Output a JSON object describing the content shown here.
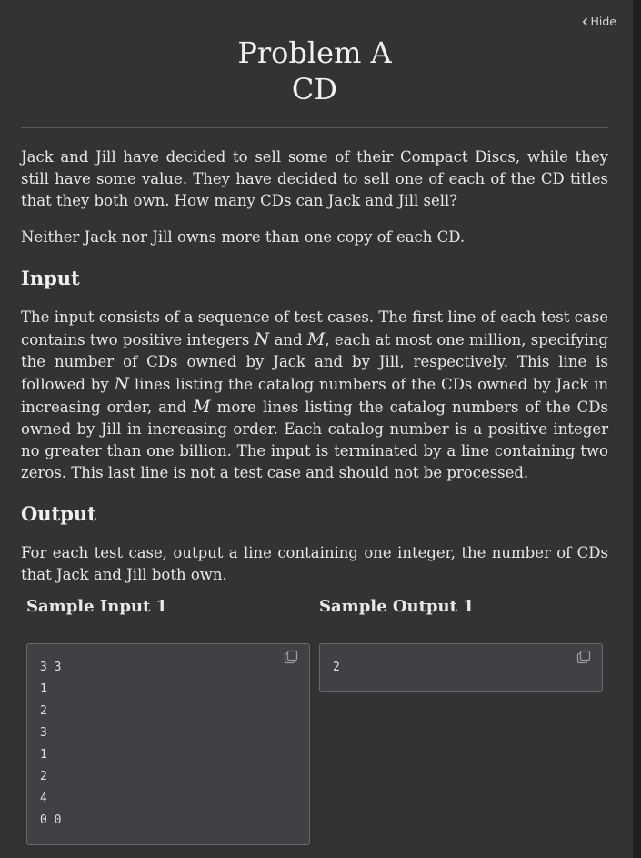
{
  "header": {
    "hide_label": "Hide",
    "title_line1": "Problem A",
    "title_line2": "CD"
  },
  "statement": {
    "p1": "Jack and Jill have decided to sell some of their Compact Discs, while they still have some value. They have decided to sell one of each of the CD titles that they both own. How many CDs can Jack and Jill sell?",
    "p2": "Neither Jack nor Jill owns more than one copy of each CD."
  },
  "input_section": {
    "heading": "Input",
    "text": [
      "The input consists of a sequence of test cases. The first line of each test case contains two positive integers ",
      "N",
      " and ",
      "M",
      ", each at most one million, specifying the number of CDs owned by Jack and by Jill, respectively. This line is followed by ",
      "N",
      " lines listing the catalog numbers of the CDs owned by Jack in increasing order, and ",
      "M",
      " more lines listing the catalog numbers of the CDs owned by Jill in increasing order. Each catalog number is a positive integer no greater than one billion. The input is terminated by a line containing two zeros. This last line is not a test case and should not be processed."
    ]
  },
  "output_section": {
    "heading": "Output",
    "text": "For each test case, output a line containing one integer, the number of CDs that Jack and Jill both own."
  },
  "samples": {
    "input_label": "Sample Input 1",
    "output_label": "Sample Output 1",
    "input_lines": [
      "3 3",
      "1",
      "2",
      "3",
      "1",
      "2",
      "4",
      "0 0"
    ],
    "output_lines": [
      "2"
    ]
  },
  "icons": {
    "hide": "chevron-left-icon",
    "copy": "copy-icon"
  }
}
